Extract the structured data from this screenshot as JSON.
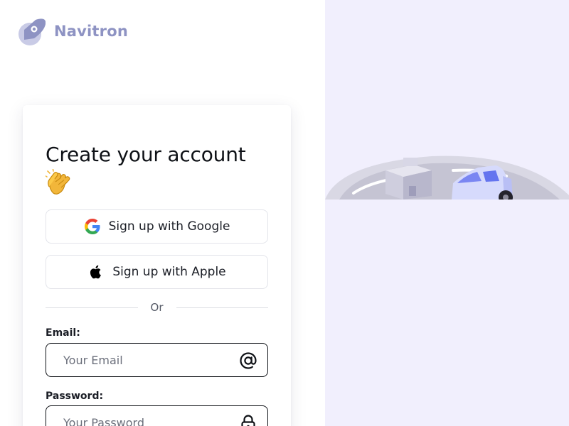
{
  "brand": {
    "name": "Navitron",
    "color": "#8e93c3"
  },
  "form": {
    "title": "Create your account",
    "title_emoji_icon": "clapping-hands-icon",
    "google_button": {
      "label": "Sign up with Google",
      "icon": "google-icon"
    },
    "apple_button": {
      "label": "Sign up with Apple",
      "icon": "apple-icon"
    },
    "divider_text": "Or",
    "email": {
      "label": "Email:",
      "placeholder": "Your Email",
      "value": "",
      "icon": "at-sign-icon"
    },
    "password": {
      "label": "Password:",
      "placeholder": "Your Password",
      "value": "",
      "icon": "lock-icon"
    }
  },
  "colors": {
    "panel_background": "#f1effd",
    "field_border": "#0e1116",
    "button_border": "#e3e4ea"
  }
}
